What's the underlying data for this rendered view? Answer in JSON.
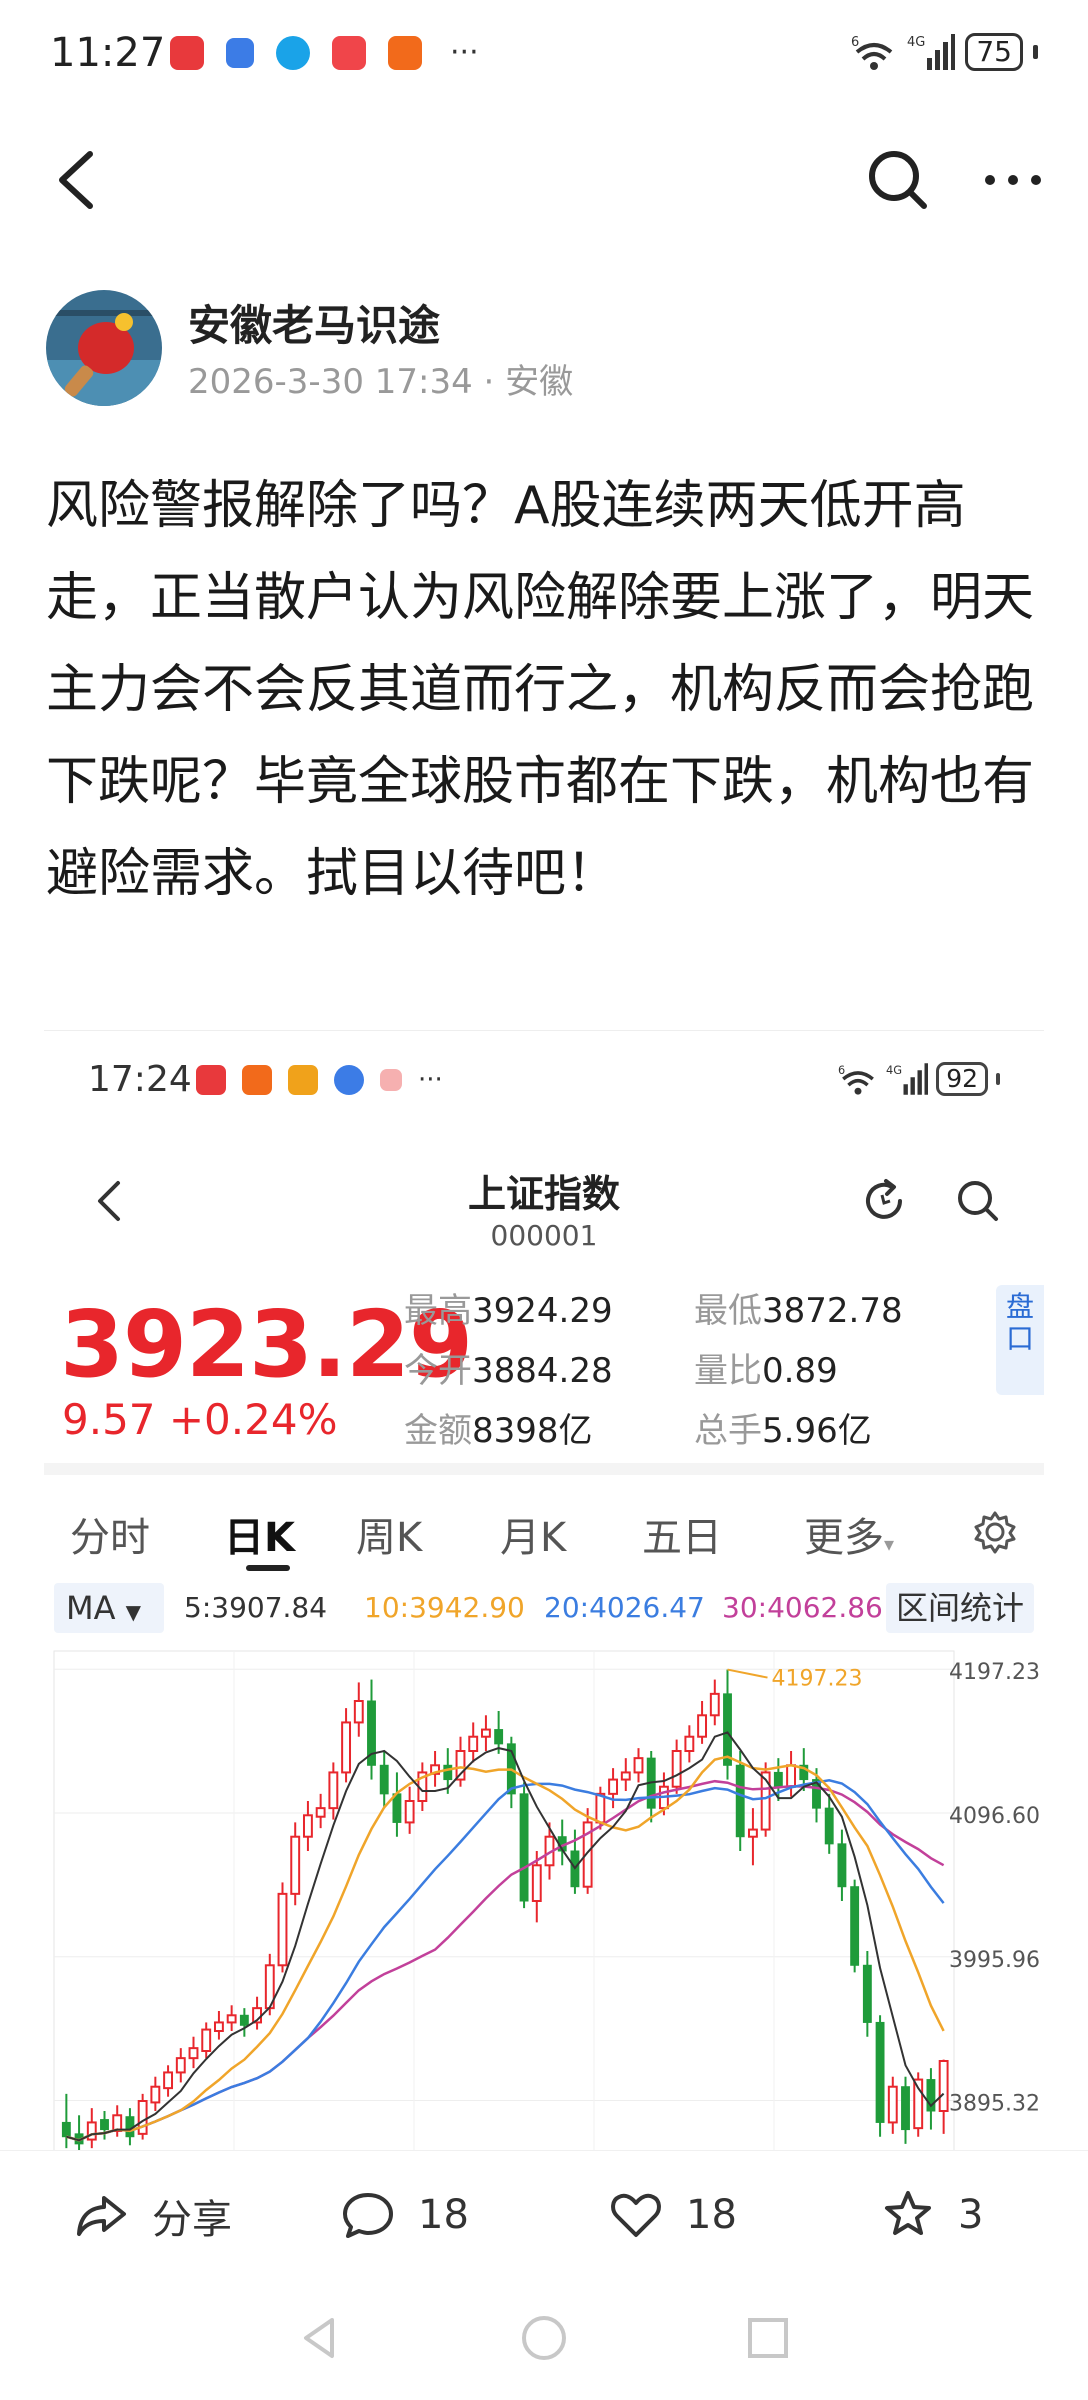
{
  "status_bar": {
    "time": "11:27",
    "network_label": "4G",
    "wifi_label": "6",
    "battery": "75",
    "more": "···"
  },
  "author": {
    "name": "安徽老马识途",
    "meta": "2026-3-30 17:34 · 安徽"
  },
  "post": {
    "text": "风险警报解除了吗？A股连续两天低开高走，正当散户认为风险解除要上涨了，明天主力会不会反其道而行之，机构反而会抢跑下跌呢？毕竟全球股市都在下跌，机构也有避险需求。拭目以待吧！"
  },
  "embedded": {
    "status_time": "17:24",
    "battery": "92",
    "network_label": "4G",
    "wifi_label": "6",
    "more": "···",
    "title": "上证指数",
    "code": "000001",
    "price": "3923.29",
    "change": "9.57  +0.24%",
    "stats": {
      "high_label": "最高",
      "high": "3924.29",
      "low_label": "最低",
      "low": "3872.78",
      "open_label": "今开",
      "open": "3884.28",
      "vol_ratio_label": "量比",
      "vol_ratio": "0.89",
      "amount_label": "金额",
      "amount": "8398亿",
      "turnover_label": "总手",
      "turnover": "5.96亿"
    },
    "pankou": "盘口",
    "tabs": [
      "分时",
      "日K",
      "周K",
      "月K",
      "五日",
      "更多"
    ],
    "active_tab": "日K",
    "ma_button": "MA",
    "ma5": "5:3907.84",
    "ma10": "10:3942.90",
    "ma20": "20:4026.47",
    "ma30": "30:4062.86",
    "range_stats": "区间统计",
    "colors": {
      "up": "#e8262c",
      "down": "#1f9b3a",
      "ma5": "#333333",
      "ma10": "#f0a52a",
      "ma20": "#3b7de0",
      "ma30": "#c2409a"
    }
  },
  "chart_data": {
    "type": "candlestick",
    "y_axis_labels": [
      "4197.23",
      "4096.60",
      "3995.96",
      "3895.32"
    ],
    "ylim": [
      3860,
      4210
    ],
    "high_marker": "4197.23",
    "candles": [
      [
        3880,
        3870,
        3900,
        3862
      ],
      [
        3872,
        3865,
        3885,
        3860
      ],
      [
        3868,
        3880,
        3890,
        3862
      ],
      [
        3882,
        3875,
        3888,
        3868
      ],
      [
        3874,
        3885,
        3892,
        3870
      ],
      [
        3884,
        3870,
        3890,
        3864
      ],
      [
        3872,
        3895,
        3900,
        3868
      ],
      [
        3894,
        3905,
        3912,
        3888
      ],
      [
        3904,
        3915,
        3920,
        3898
      ],
      [
        3915,
        3925,
        3932,
        3908
      ],
      [
        3925,
        3932,
        3940,
        3918
      ],
      [
        3930,
        3945,
        3950,
        3925
      ],
      [
        3944,
        3950,
        3958,
        3938
      ],
      [
        3950,
        3955,
        3962,
        3944
      ],
      [
        3955,
        3948,
        3960,
        3940
      ],
      [
        3950,
        3960,
        3968,
        3945
      ],
      [
        3960,
        3990,
        3998,
        3955
      ],
      [
        3990,
        4040,
        4048,
        3985
      ],
      [
        4040,
        4080,
        4090,
        4032
      ],
      [
        4080,
        4095,
        4105,
        4070
      ],
      [
        4094,
        4100,
        4110,
        4086
      ],
      [
        4100,
        4125,
        4132,
        4092
      ],
      [
        4125,
        4160,
        4170,
        4118
      ],
      [
        4160,
        4175,
        4188,
        4150
      ],
      [
        4175,
        4130,
        4190,
        4120
      ],
      [
        4130,
        4110,
        4140,
        4100
      ],
      [
        4110,
        4090,
        4125,
        4080
      ],
      [
        4090,
        4105,
        4115,
        4082
      ],
      [
        4105,
        4125,
        4132,
        4098
      ],
      [
        4124,
        4130,
        4140,
        4115
      ],
      [
        4130,
        4120,
        4142,
        4110
      ],
      [
        4120,
        4140,
        4150,
        4115
      ],
      [
        4140,
        4150,
        4160,
        4132
      ],
      [
        4150,
        4155,
        4165,
        4140
      ],
      [
        4155,
        4145,
        4168,
        4138
      ],
      [
        4145,
        4110,
        4150,
        4100
      ],
      [
        4110,
        4035,
        4118,
        4030
      ],
      [
        4035,
        4060,
        4070,
        4020
      ],
      [
        4060,
        4080,
        4090,
        4050
      ],
      [
        4080,
        4070,
        4092,
        4060
      ],
      [
        4070,
        4045,
        4085,
        4040
      ],
      [
        4045,
        4090,
        4100,
        4040
      ],
      [
        4090,
        4110,
        4115,
        4085
      ],
      [
        4110,
        4120,
        4128,
        4100
      ],
      [
        4120,
        4125,
        4135,
        4112
      ],
      [
        4125,
        4135,
        4142,
        4118
      ],
      [
        4135,
        4100,
        4140,
        4090
      ],
      [
        4100,
        4115,
        4125,
        4095
      ],
      [
        4115,
        4140,
        4148,
        4110
      ],
      [
        4140,
        4150,
        4158,
        4132
      ],
      [
        4150,
        4165,
        4175,
        4145
      ],
      [
        4165,
        4180,
        4190,
        4158
      ],
      [
        4180,
        4130,
        4197,
        4120
      ],
      [
        4130,
        4080,
        4140,
        4070
      ],
      [
        4080,
        4085,
        4100,
        4060
      ],
      [
        4085,
        4125,
        4132,
        4080
      ],
      [
        4125,
        4115,
        4135,
        4105
      ],
      [
        4115,
        4130,
        4140,
        4108
      ],
      [
        4130,
        4120,
        4142,
        4112
      ],
      [
        4120,
        4100,
        4128,
        4090
      ],
      [
        4100,
        4075,
        4110,
        4068
      ],
      [
        4075,
        4045,
        4085,
        4035
      ],
      [
        4045,
        3990,
        4050,
        3985
      ],
      [
        3990,
        3950,
        4000,
        3940
      ],
      [
        3950,
        3880,
        3955,
        3870
      ],
      [
        3880,
        3905,
        3912,
        3872
      ],
      [
        3905,
        3875,
        3912,
        3865
      ],
      [
        3876,
        3910,
        3915,
        3870
      ],
      [
        3910,
        3888,
        3918,
        3875
      ],
      [
        3888,
        3923,
        3924,
        3872
      ]
    ]
  },
  "actions": {
    "share_label": "分享",
    "comments": "18",
    "likes": "18",
    "favorites": "3"
  }
}
